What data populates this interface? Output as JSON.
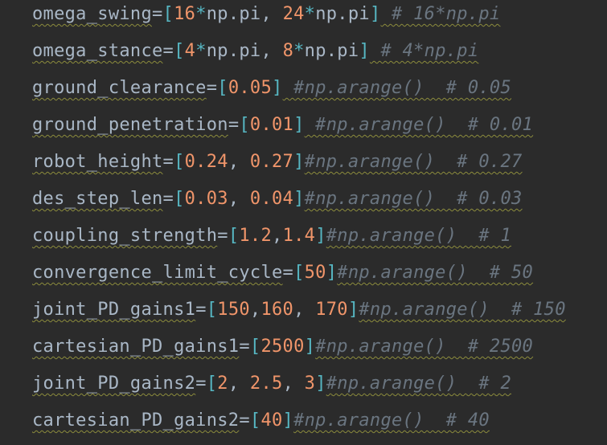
{
  "lines": [
    {
      "name": "omega-swing-line",
      "var": "omega_swing",
      "segments": [
        "=",
        "[",
        "16",
        "*",
        "np.pi",
        ", ",
        "24",
        "*",
        "np.pi",
        "]"
      ],
      "comment": " # 16*np.pi"
    },
    {
      "name": "omega-stance-line",
      "var": "omega_stance",
      "segments": [
        "=",
        "[",
        "4",
        "*",
        "np.pi",
        ", ",
        "8",
        "*",
        "np.pi",
        "]"
      ],
      "comment": " # 4*np.pi"
    },
    {
      "name": "ground-clearance-line",
      "var": "ground_clearance",
      "segments": [
        "=",
        "[",
        "0.05",
        "]"
      ],
      "comment": " #np.arange()  # 0.05"
    },
    {
      "name": "ground-penetration-line",
      "var": "ground_penetration",
      "segments": [
        "=",
        "[",
        "0.01",
        "]"
      ],
      "comment": " #np.arange()  # 0.01"
    },
    {
      "name": "robot-height-line",
      "var": "robot_height",
      "segments": [
        "=",
        "[",
        "0.24",
        ", ",
        "0.27",
        "]"
      ],
      "comment": "#np.arange()  # 0.27"
    },
    {
      "name": "des-step-len-line",
      "var": "des_step_len",
      "segments": [
        "=",
        "[",
        "0.03",
        ", ",
        "0.04",
        "]"
      ],
      "comment": "#np.arange()  # 0.03"
    },
    {
      "name": "coupling-strength-line",
      "var": "coupling_strength",
      "segments": [
        "=",
        "[",
        "1.2",
        ",",
        "1.4",
        "]"
      ],
      "comment": "#np.arange()  # 1"
    },
    {
      "name": "convergence-limit-cycle-line",
      "var": "convergence_limit_cycle",
      "segments": [
        "=",
        "[",
        "50",
        "]"
      ],
      "comment": "#np.arange()  # 50"
    },
    {
      "name": "joint-pd-gains1-line",
      "var": "joint_PD_gains1",
      "segments": [
        "=",
        "[",
        "150",
        ",",
        "160",
        ", ",
        "170",
        "]"
      ],
      "comment": "#np.arange()  # 150"
    },
    {
      "name": "cartesian-pd-gains1-line",
      "var": "cartesian_PD_gains1",
      "segments": [
        "=",
        "[",
        "2500",
        "]"
      ],
      "comment": "#np.arange()  # 2500"
    },
    {
      "name": "joint-pd-gains2-line",
      "var": "joint_PD_gains2",
      "segments": [
        "=",
        "[",
        "2",
        ", ",
        "2.5",
        ", ",
        "3",
        "]"
      ],
      "comment": "#np.arange()  # 2"
    },
    {
      "name": "cartesian-pd-gains2-line",
      "var": "cartesian_PD_gains2",
      "segments": [
        "=",
        "[",
        "40",
        "]"
      ],
      "comment": "#np.arange()  # 40"
    }
  ],
  "colors": {
    "background": "#2b2b2b",
    "identifier": "#a9b7c6",
    "bracket": "#56b6c2",
    "number": "#f0956a",
    "comment": "#6a7580",
    "squiggle": "#8c8c3c"
  }
}
